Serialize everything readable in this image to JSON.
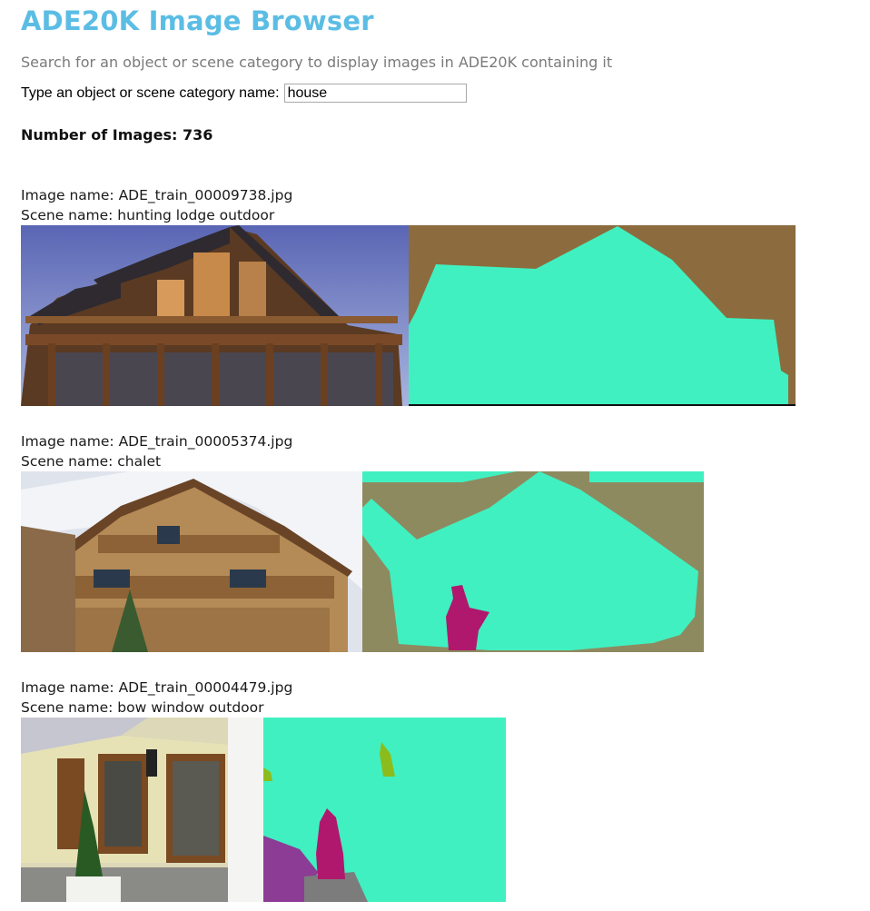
{
  "header": {
    "title": "ADE20K Image Browser",
    "subtitle": "Search for an object or scene category to display images in ADE20K containing it"
  },
  "search": {
    "label": "Type an object or scene category name:",
    "value": "house"
  },
  "results": {
    "count_text": "Number of Images: 736",
    "items": [
      {
        "image_name": "Image name: ADE_train_00009738.jpg",
        "scene_name": "Scene name: hunting lodge outdoor"
      },
      {
        "image_name": "Image name: ADE_train_00005374.jpg",
        "scene_name": "Scene name: chalet"
      },
      {
        "image_name": "Image name: ADE_train_00004479.jpg",
        "scene_name": "Scene name: bow window outdoor"
      }
    ]
  },
  "colors": {
    "title": "#5bbde4",
    "seg_house": "#40f0c0",
    "seg_sky_1": "#8c6c3e",
    "seg_sky_2": "#8e8a60",
    "seg_tree": "#b0186e",
    "seg_plant": "#8cbc1c",
    "seg_purple": "#8c3c94",
    "seg_gray": "#7c7c7c"
  }
}
